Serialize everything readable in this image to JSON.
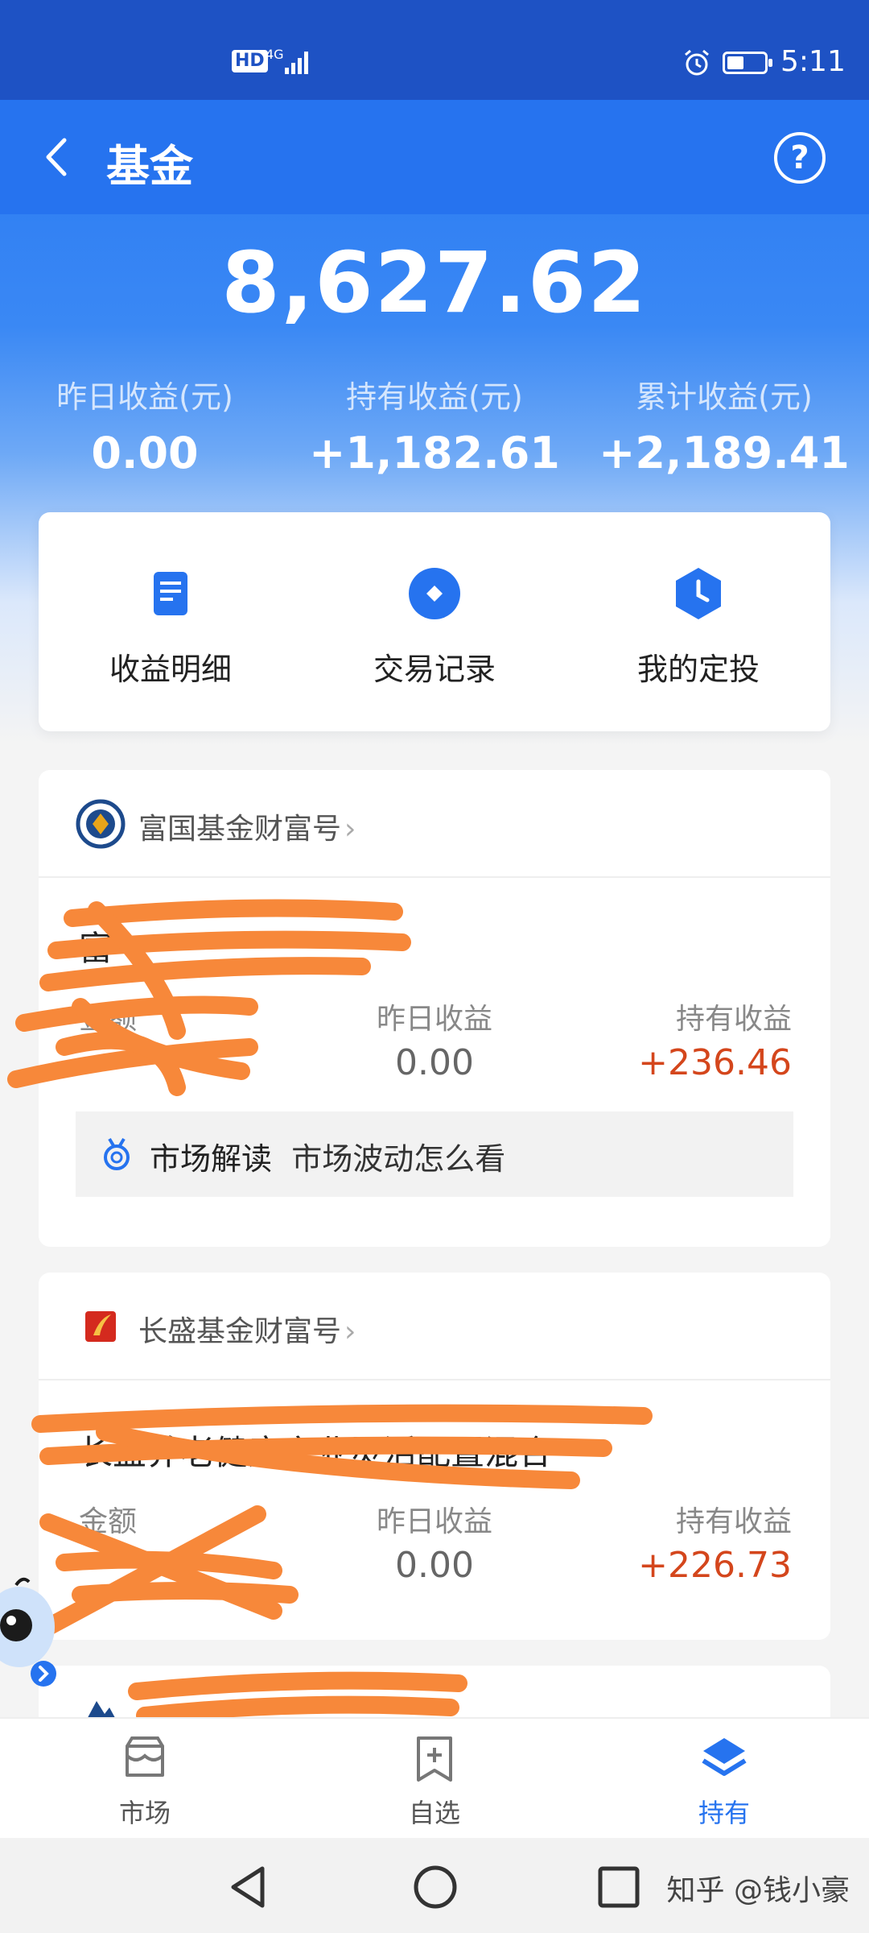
{
  "status_bar": {
    "hd": "HD",
    "network": "4G",
    "time": "5:11",
    "battery_level": 0.45
  },
  "header": {
    "title": "基金"
  },
  "summary": {
    "total": "8,627.62",
    "stats": [
      {
        "label": "昨日收益(元)",
        "value": "0.00"
      },
      {
        "label": "持有收益(元)",
        "value": "+1,182.61"
      },
      {
        "label": "累计收益(元)",
        "value": "+2,189.41"
      }
    ]
  },
  "quick_actions": [
    {
      "label": "收益明细",
      "icon": "document-icon"
    },
    {
      "label": "交易记录",
      "icon": "diamond-icon"
    },
    {
      "label": "我的定投",
      "icon": "clock-icon"
    }
  ],
  "funds": [
    {
      "brand": "富国基金财富号",
      "name": "富",
      "amount_label": "金额",
      "yesterday_label": "昨日收益",
      "yesterday_value": "0.00",
      "holding_label": "持有收益",
      "holding_value": "+236.46",
      "market_title": "市场解读",
      "market_text": "市场波动怎么看"
    },
    {
      "brand": "长盛基金财富号",
      "name": "长盛养老健康产业灵活配置混合",
      "amount_label": "金额",
      "yesterday_label": "昨日收益",
      "yesterday_value": "0.00",
      "holding_label": "持有收益",
      "holding_value": "+226.73"
    }
  ],
  "tabs": [
    {
      "label": "市场",
      "icon": "market-icon"
    },
    {
      "label": "自选",
      "icon": "watchlist-icon"
    },
    {
      "label": "持有",
      "icon": "layers-icon",
      "active": true
    }
  ],
  "watermark": "知乎 @钱小豪",
  "colors": {
    "primary": "#2673ef",
    "status_bar": "#1e52c4",
    "gain": "#d4461c",
    "scribble": "#f7883a"
  }
}
